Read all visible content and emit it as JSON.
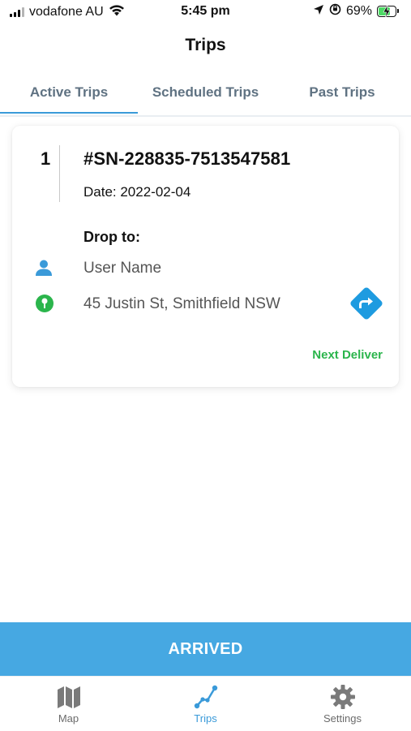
{
  "status_bar": {
    "carrier": "vodafone AU",
    "time": "5:45 pm",
    "battery_percent": "69%",
    "battery_level": 0.69
  },
  "header": {
    "title": "Trips"
  },
  "tabs": [
    {
      "label": "Active Trips",
      "active": true
    },
    {
      "label": "Scheduled Trips",
      "active": false
    },
    {
      "label": "Past Trips",
      "active": false
    }
  ],
  "trip": {
    "index": "1",
    "order_id": "#SN-228835-7513547581",
    "date": "Date: 2022-02-04",
    "drop_to_label": "Drop to:",
    "recipient": "User Name",
    "address": "45 Justin St, Smithfield NSW",
    "next_action": "Next Deliver"
  },
  "arrived_button": "ARRIVED",
  "bottom_nav": [
    {
      "label": "Map",
      "icon": "map-icon",
      "active": false
    },
    {
      "label": "Trips",
      "icon": "route-icon",
      "active": true
    },
    {
      "label": "Settings",
      "icon": "gear-icon",
      "active": false
    }
  ],
  "colors": {
    "accent": "#46a8e2",
    "tab_active_indicator": "#3a9ad9",
    "success": "#2bb54c",
    "battery": "#4cd964",
    "nav_direction": "#1e9be0"
  }
}
